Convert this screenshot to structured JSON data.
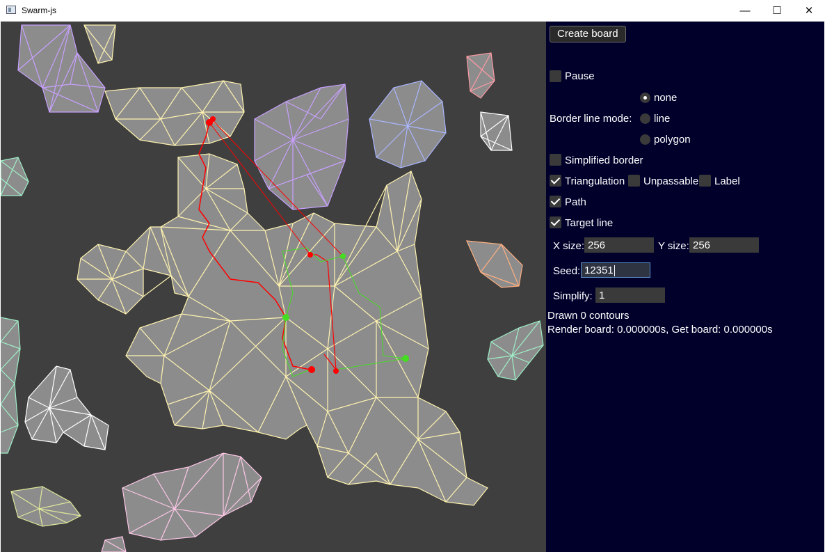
{
  "window": {
    "title": "Swarm-js",
    "minimize": "—",
    "maximize": "☐",
    "close": "✕"
  },
  "panel": {
    "create_board": "Create board",
    "pause": {
      "label": "Pause",
      "checked": false
    },
    "border_line_mode": {
      "label": "Border line mode:",
      "options": [
        "none",
        "line",
        "polygon"
      ],
      "selected": "none"
    },
    "simplified_border": {
      "label": "Simplified border",
      "checked": false
    },
    "triangulation": {
      "label": "Triangulation",
      "checked": true
    },
    "unpassable": {
      "label": "Unpassable",
      "checked": false
    },
    "label_opt": {
      "label": "Label",
      "checked": false
    },
    "path": {
      "label": "Path",
      "checked": true
    },
    "target_line": {
      "label": "Target line",
      "checked": true
    },
    "x_size": {
      "label": "X size:",
      "value": "256"
    },
    "y_size": {
      "label": "Y size:",
      "value": "256"
    },
    "seed": {
      "label": "Seed:",
      "value": "12351"
    },
    "simplify": {
      "label": "Simplify:",
      "value": "1"
    },
    "status": {
      "contours": "Drawn 0 contours",
      "timing": "Render board: 0.000000s, Get board: 0.000000s"
    }
  },
  "colors": {
    "board_bg": "#3f3f3f",
    "region_fill": "#8c8c8c",
    "panel_bg": "#00002b",
    "path_red": "#ff0000",
    "path_green": "#44dd22",
    "edge_yellow": "#fff3b0",
    "edge_purple": "#c8a0ff",
    "edge_blue": "#aab6ff",
    "edge_pink": "#ffc8e8",
    "edge_white": "#ffffff",
    "edge_teal": "#9ff0c8",
    "edge_red": "#ff9aa6",
    "edge_orange": "#ffb080"
  }
}
